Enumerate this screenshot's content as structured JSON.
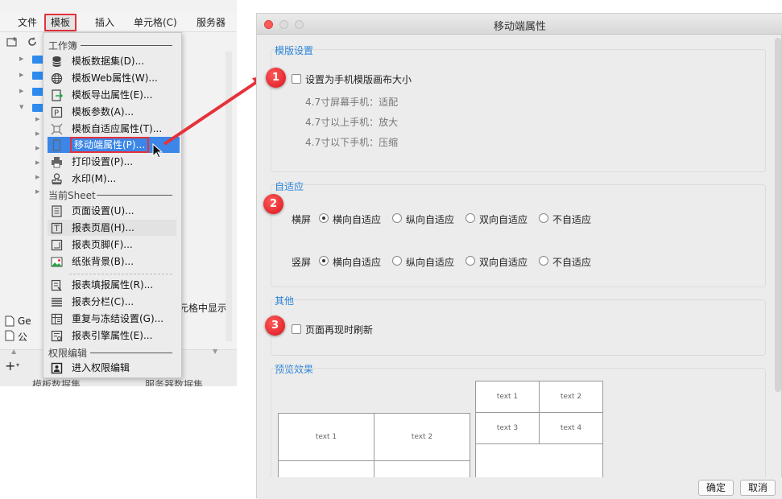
{
  "menubar": {
    "items": [
      "文件",
      "模板",
      "插入",
      "单元格(C)",
      "服务器"
    ]
  },
  "left_panel": {
    "file_rows": [
      "Ge",
      "公"
    ],
    "cell_text": "元格中显示",
    "bottom_tabs": [
      "模板数据集",
      "服务器数据集"
    ]
  },
  "dropdown": {
    "section_workbook": "工作簿",
    "items_workbook": [
      {
        "label": "模板数据集(D)...",
        "icon": "database-icon"
      },
      {
        "label": "模板Web属性(W)...",
        "icon": "globe-icon"
      },
      {
        "label": "模板导出属性(E)...",
        "icon": "export-icon"
      },
      {
        "label": "模板参数(A)...",
        "icon": "parameter-icon"
      },
      {
        "label": "模板自适应属性(T)...",
        "icon": "adaptive-icon"
      },
      {
        "label": "移动端属性(P)...",
        "icon": "mobile-icon"
      },
      {
        "label": "打印设置(P)...",
        "icon": "printer-icon"
      },
      {
        "label": "水印(M)...",
        "icon": "stamp-icon"
      }
    ],
    "section_sheet": "当前Sheet",
    "items_sheet": [
      {
        "label": "页面设置(U)...",
        "icon": "page-setup-icon"
      },
      {
        "label": "报表页眉(H)...",
        "icon": "header-icon"
      },
      {
        "label": "报表页脚(F)...",
        "icon": "footer-icon"
      },
      {
        "label": "纸张背景(B)...",
        "icon": "background-image-icon"
      }
    ],
    "items_sheet2": [
      {
        "label": "报表填报属性(R)...",
        "icon": "fill-report-icon"
      },
      {
        "label": "报表分栏(C)...",
        "icon": "columns-icon"
      },
      {
        "label": "重复与冻结设置(G)...",
        "icon": "freeze-icon"
      },
      {
        "label": "报表引擎属性(E)...",
        "icon": "engine-icon"
      }
    ],
    "section_permission": "权限编辑",
    "items_permission": [
      {
        "label": "进入权限编辑",
        "icon": "permission-icon"
      }
    ]
  },
  "dialog": {
    "title": "移动端属性",
    "template_section": {
      "title": "模版设置",
      "checkbox_label": "设置为手机模版画布大小",
      "notes": [
        "4.7寸屏幕手机：适配",
        "4.7寸以上手机：放大",
        "4.7寸以下手机：压缩"
      ]
    },
    "adaptive_section": {
      "title": "自适应",
      "rows": [
        {
          "label": "横屏",
          "options": [
            "横向自适应",
            "纵向自适应",
            "双向自适应",
            "不自适应"
          ],
          "selected": 0
        },
        {
          "label": "竖屏",
          "options": [
            "横向自适应",
            "纵向自适应",
            "双向自适应",
            "不自适应"
          ],
          "selected": 0
        }
      ]
    },
    "other_section": {
      "title": "其他",
      "checkbox_label": "页面再现时刷新"
    },
    "preview_section": {
      "title": "预览效果",
      "cells_large": [
        "text 1",
        "text 2"
      ],
      "cells_small": [
        "text 1",
        "text 2",
        "text 3",
        "text 4"
      ]
    },
    "buttons": {
      "ok": "确定",
      "cancel": "取消"
    }
  },
  "markers": [
    "1",
    "2",
    "3"
  ],
  "colors": {
    "accent_blue": "#3b86e8",
    "highlight_red": "#e5323b",
    "section_title": "#2b84d8"
  }
}
